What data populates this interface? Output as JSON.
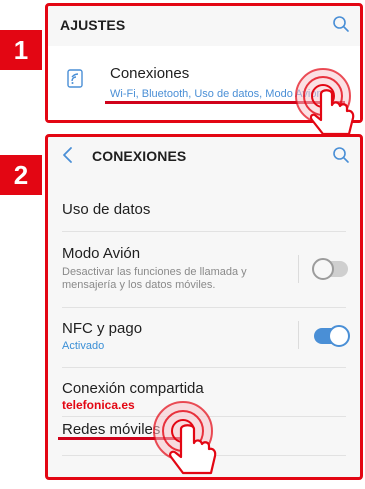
{
  "steps": [
    "1",
    "2"
  ],
  "screen1": {
    "title": "AJUSTES",
    "item": {
      "title": "Conexiones",
      "subtitle": "Wi-Fi, Bluetooth, Uso de datos, Modo Avión"
    }
  },
  "screen2": {
    "title": "CONEXIONES",
    "items": [
      {
        "title": "Uso de datos"
      },
      {
        "title": "Modo Avión",
        "subtitle": "Desactivar las funciones de llamada y mensajería y los datos móviles.",
        "toggle": false
      },
      {
        "title": "NFC y pago",
        "status": "Activado",
        "toggle": true
      },
      {
        "title": "Conexión compartida",
        "brand": "telefonica.es"
      },
      {
        "title": "Redes móviles"
      }
    ]
  },
  "colors": {
    "accent": "#e30613",
    "blue": "#4a8fd6"
  },
  "icons": [
    "search-icon",
    "wifi-icon",
    "back-icon",
    "tap-hand-icon"
  ]
}
